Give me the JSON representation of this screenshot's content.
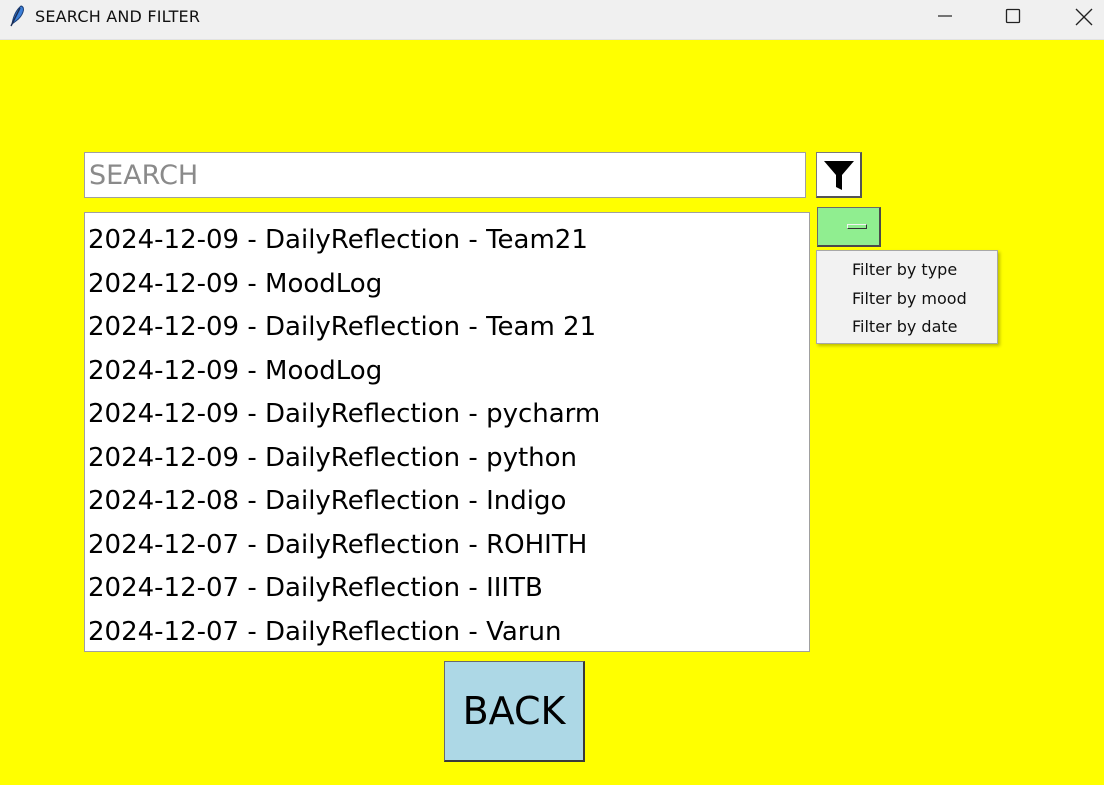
{
  "window": {
    "title": "SEARCH AND FILTER",
    "icon": "feather-icon",
    "controls": [
      "minimize-icon",
      "maximize-icon",
      "close-icon"
    ],
    "background": "#ffff00"
  },
  "search": {
    "placeholder": "SEARCH",
    "value": ""
  },
  "filter_button": {
    "icon": "funnel-icon"
  },
  "filter_menu": {
    "button_color": "#90ee90",
    "items": [
      "Filter by type",
      "Filter by mood",
      "Filter by date"
    ]
  },
  "entries": [
    "2024-12-09 - DailyReflection - Team21",
    "2024-12-09 - MoodLog",
    "2024-12-09 - DailyReflection - Team 21",
    "2024-12-09 - MoodLog",
    "2024-12-09 - DailyReflection - pycharm",
    "2024-12-09 - DailyReflection - python",
    "2024-12-08 - DailyReflection - Indigo",
    "2024-12-07 - DailyReflection - ROHITH",
    "2024-12-07 - DailyReflection - IIITB",
    "2024-12-07 - DailyReflection - Varun"
  ],
  "back_button": {
    "label": "BACK",
    "color": "#add8e6"
  }
}
